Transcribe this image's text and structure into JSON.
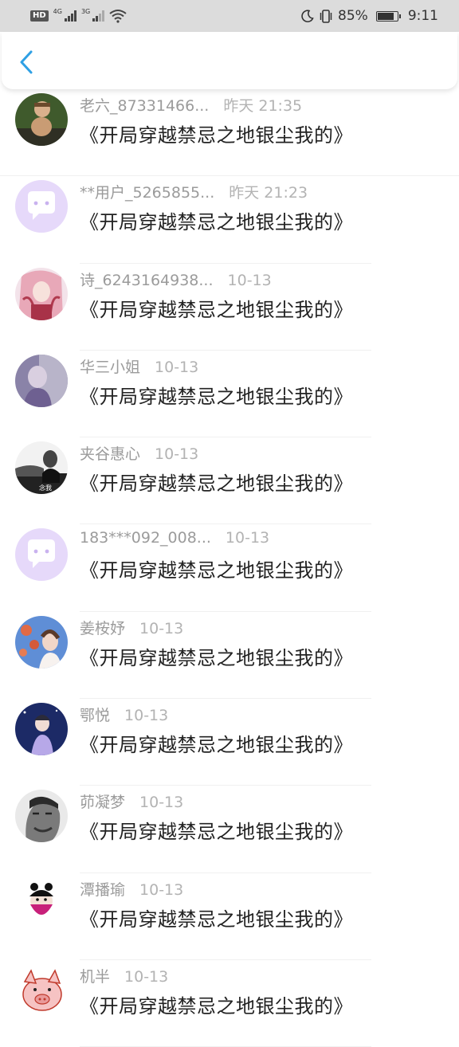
{
  "status_bar": {
    "hd": "HD",
    "net1": "4G",
    "net2": "3G",
    "battery_percent": "85%",
    "battery_level": 0.85,
    "time": "9:11"
  },
  "header": {
    "back_icon": "chevron-left-icon",
    "accent": "#2fa0e4"
  },
  "comments": [
    {
      "name": "老六_87331466...",
      "time": "昨天 21:35",
      "text": "《开局穿越禁忌之地银尘我的》",
      "avatar": "photo-child"
    },
    {
      "name": "**用户_5265855...",
      "time": "昨天 21:23",
      "text": "《开局穿越禁忌之地银尘我的》",
      "avatar": "default-chat-bubble"
    },
    {
      "name": "诗_6243164938...",
      "time": "10-13",
      "text": "《开局穿越禁忌之地银尘我的》",
      "avatar": "photo-anime-girl-pink"
    },
    {
      "name": "华三小姐",
      "time": "10-13",
      "text": "《开局穿越禁忌之地银尘我的》",
      "avatar": "photo-purple-figure"
    },
    {
      "name": "夹谷惠心",
      "time": "10-13",
      "text": "《开局穿越禁忌之地银尘我的》",
      "avatar": "photo-bw-girl",
      "avatar_caption": "念我"
    },
    {
      "name": "183***092_008...",
      "time": "10-13",
      "text": "《开局穿越禁忌之地银尘我的》",
      "avatar": "default-chat-bubble"
    },
    {
      "name": "姜桉妤",
      "time": "10-13",
      "text": "《开局穿越禁忌之地银尘我的》",
      "avatar": "photo-flowers-girl"
    },
    {
      "name": "鄂悦",
      "time": "10-13",
      "text": "《开局穿越禁忌之地银尘我的》",
      "avatar": "photo-anime-boy-night"
    },
    {
      "name": "茆凝梦",
      "time": "10-13",
      "text": "《开局穿越禁忌之地银尘我的》",
      "avatar": "photo-bw-man"
    },
    {
      "name": "潭播瑜",
      "time": "10-13",
      "text": "《开局穿越禁忌之地银尘我的》",
      "avatar": "cartoon-masked-girl"
    },
    {
      "name": "机半",
      "time": "10-13",
      "text": "《开局穿越禁忌之地银尘我的》",
      "avatar": "cartoon-pig"
    }
  ]
}
